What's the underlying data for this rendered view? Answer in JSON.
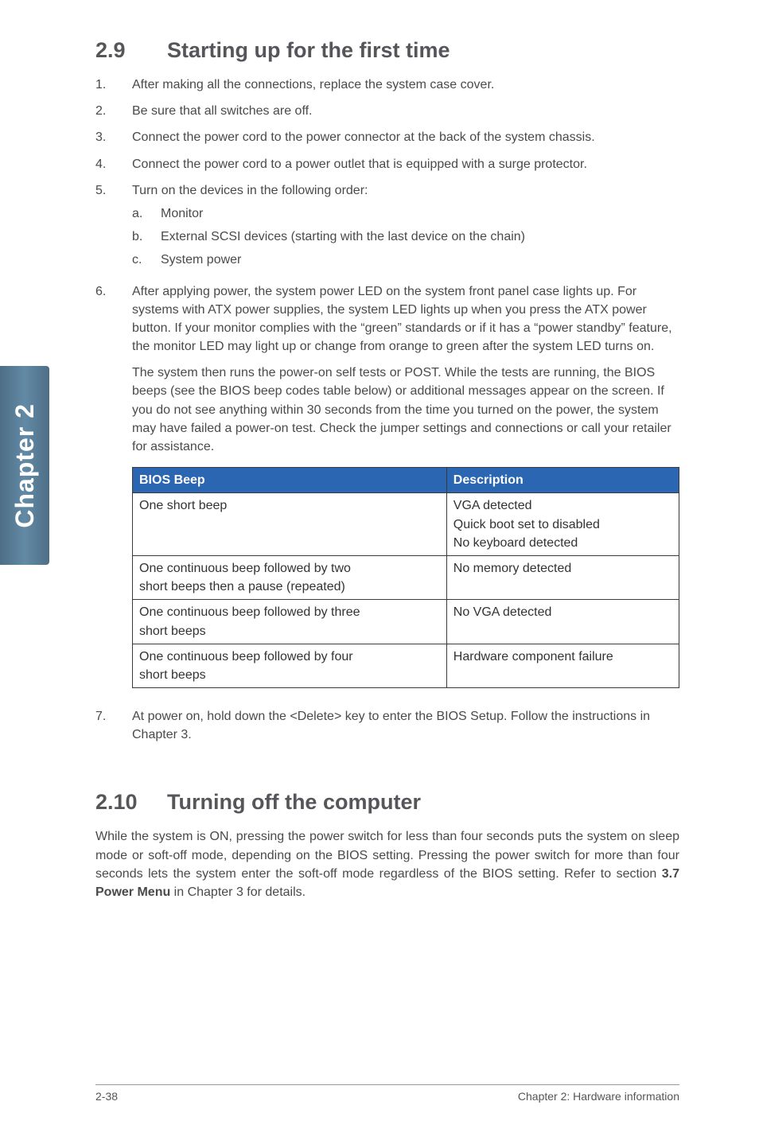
{
  "sidebar": {
    "label": "Chapter 2"
  },
  "section29": {
    "num": "2.9",
    "title": "Starting up for the first time",
    "items": [
      {
        "n": "1.",
        "t": "After making all the connections, replace the system case cover."
      },
      {
        "n": "2.",
        "t": "Be sure that all switches are off."
      },
      {
        "n": "3.",
        "t": "Connect the power cord to the power connector at the back of the system chassis."
      },
      {
        "n": "4.",
        "t": "Connect the power cord to a power outlet that is equipped with a surge protector."
      },
      {
        "n": "5.",
        "t": "Turn on the devices in the following order:"
      }
    ],
    "sub5": [
      {
        "n": "a.",
        "t": "Monitor"
      },
      {
        "n": "b.",
        "t": "External SCSI devices (starting with the last device on the chain)"
      },
      {
        "n": "c.",
        "t": "System power"
      }
    ],
    "item6n": "6.",
    "item6p1": "After applying power, the system power LED on the system front panel case lights up. For systems with ATX power supplies, the system LED lights up when you press the ATX power button. If your monitor complies with the “green” standards or if it has a “power standby” feature, the monitor LED may light up or change from orange to green after the system LED turns on.",
    "item6p2": "The system then runs the power-on self tests or POST. While the tests are running, the BIOS beeps (see the BIOS beep codes table below) or additional messages appear on the screen. If you do not see anything within 30 seconds from the time you turned on the power, the system may have failed a power-on test. Check the jumper settings and connections or call your retailer for assistance.",
    "table": {
      "h1": "BIOS Beep",
      "h2": "Description",
      "rows": [
        {
          "c1": "One short beep",
          "c2a": "VGA detected",
          "c2b": "Quick boot set to disabled",
          "c2c": "No keyboard detected"
        },
        {
          "c1a": "One continuous beep followed by two",
          "c1b": "short beeps then a pause (repeated)",
          "c2": "No memory detected"
        },
        {
          "c1a": "One continuous beep followed by three",
          "c1b": "short beeps",
          "c2": "No VGA detected"
        },
        {
          "c1a": "One continuous beep followed by four",
          "c1b": "short beeps",
          "c2": "Hardware component failure"
        }
      ]
    },
    "item7n": "7.",
    "item7t": "At power on, hold down the <Delete> key to enter the BIOS Setup. Follow the instructions in Chapter 3."
  },
  "section210": {
    "num": "2.10",
    "title": "Turning off the computer",
    "body_pre": "While the system is ON, pressing the power switch for less than four seconds puts the system on sleep mode or soft-off mode, depending on the BIOS setting. Pressing the power switch for more than four seconds lets the system enter the soft-off mode regardless of the BIOS setting. Refer to section ",
    "body_bold": "3.7 Power Menu",
    "body_post": " in Chapter 3 for details."
  },
  "footer": {
    "left": "2-38",
    "right": "Chapter 2: Hardware information"
  }
}
